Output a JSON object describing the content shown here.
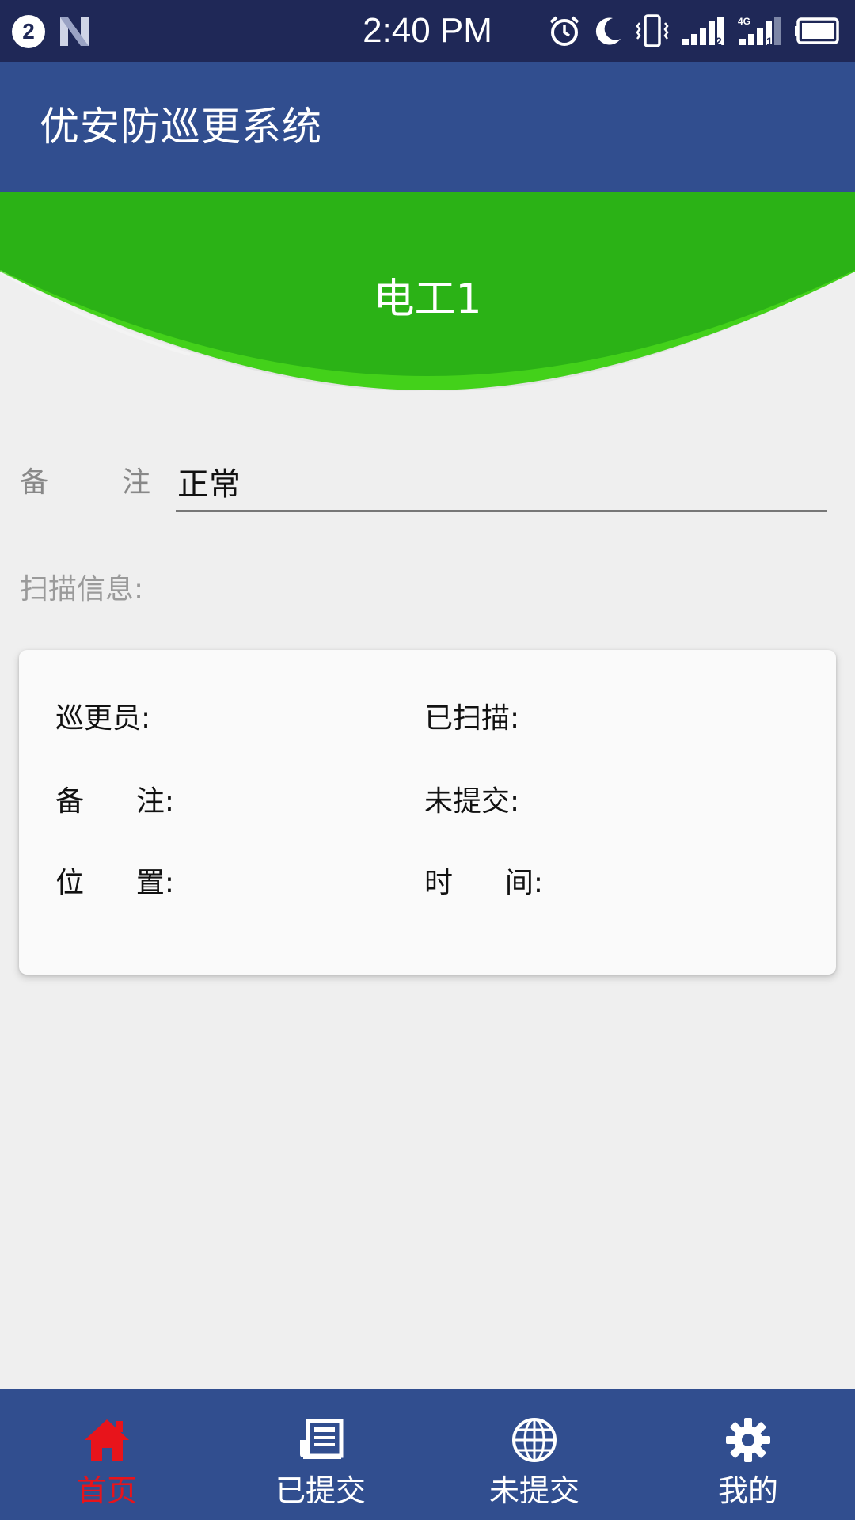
{
  "status_bar": {
    "notification_count": "2",
    "time": "2:40 PM",
    "icons": [
      "n-icon",
      "alarm-icon",
      "moon-icon",
      "vibrate-icon",
      "signal-1-icon",
      "signal-2-icon",
      "battery-icon"
    ],
    "network_label": "4G",
    "sim1": "2",
    "sim2": "1"
  },
  "app_bar": {
    "title": "优安防巡更系统"
  },
  "banner": {
    "title": "电工1",
    "color": "#2bb216"
  },
  "remark": {
    "label_left": "备",
    "label_right": "注",
    "value": "正常"
  },
  "scan_info": {
    "title": "扫描信息:",
    "fields": {
      "patroller": "巡更员:",
      "scanned": "已扫描:",
      "remark_left": "备",
      "remark_right": "注:",
      "unsubmitted": "未提交:",
      "location_left": "位",
      "location_right": "置:",
      "time_left": "时",
      "time_right": "间:"
    }
  },
  "bottom_nav": {
    "items": [
      {
        "label": "首页",
        "icon": "home-icon",
        "active": true
      },
      {
        "label": "已提交",
        "icon": "document-icon",
        "active": false
      },
      {
        "label": "未提交",
        "icon": "globe-icon",
        "active": false
      },
      {
        "label": "我的",
        "icon": "gear-icon",
        "active": false
      }
    ],
    "active_color": "#e8141b"
  },
  "colors": {
    "status_bar": "#1f2857",
    "app_bar": "#314e8f",
    "background": "#efefef"
  }
}
